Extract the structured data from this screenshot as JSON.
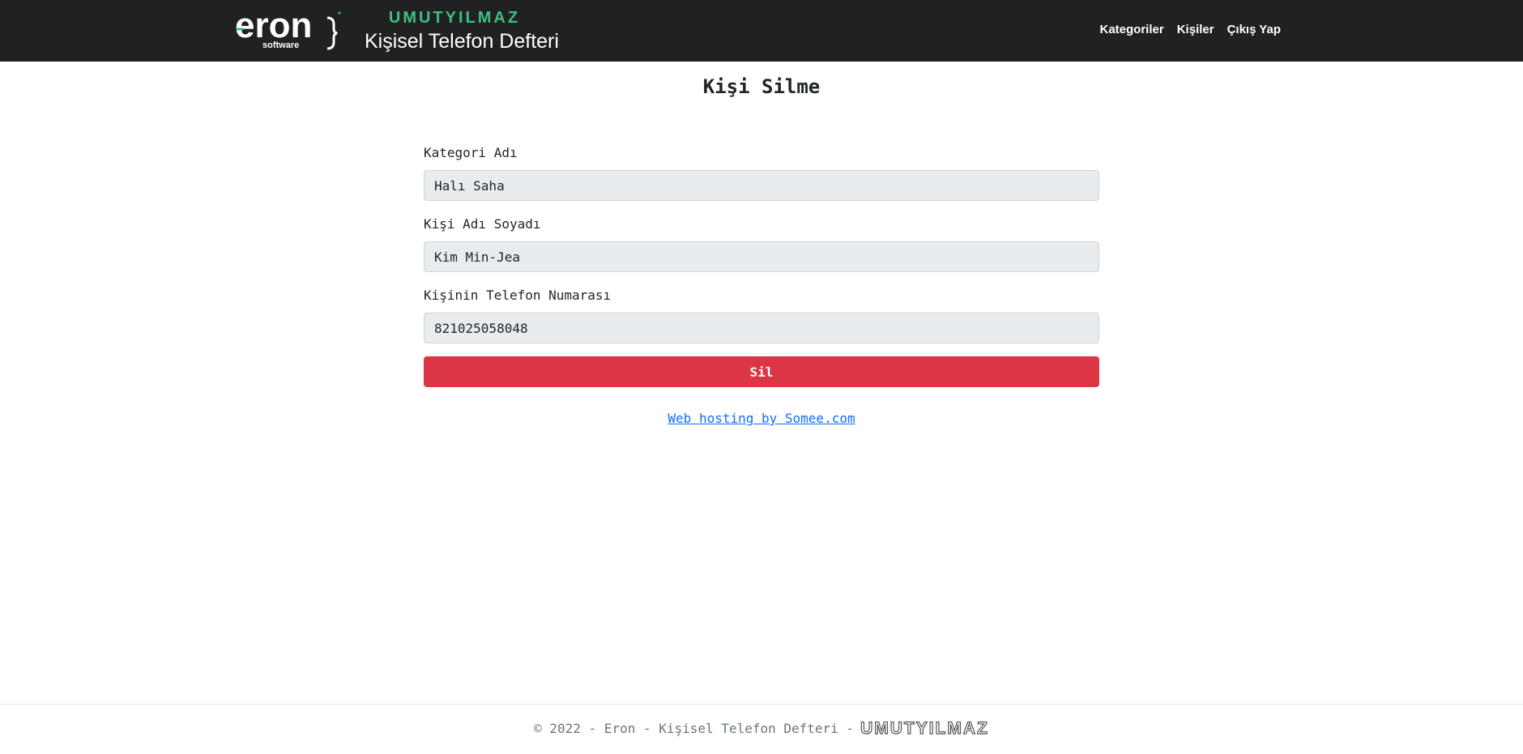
{
  "header": {
    "logo_text": "eron",
    "logo_subtext": "software",
    "brand_name": "UMUTYILMAZ",
    "brand_subtitle": "Kişisel Telefon Defteri",
    "nav": [
      {
        "label": "Kategoriler"
      },
      {
        "label": "Kişiler"
      },
      {
        "label": "Çıkış Yap"
      }
    ],
    "accent_color": "#3fbf82"
  },
  "main": {
    "title": "Kişi Silme",
    "fields": [
      {
        "label": "Kategori Adı",
        "value": "Halı Saha"
      },
      {
        "label": "Kişi Adı Soyadı",
        "value": "Kim Min-Jea"
      },
      {
        "label": "Kişinin Telefon Numarası",
        "value": "821025058048"
      }
    ],
    "submit_label": "Sil",
    "submit_color": "#dc3545"
  },
  "hosting": {
    "link_text": "Web hosting by Somee.com"
  },
  "footer": {
    "text": "© 2022 - Eron - Kişisel Telefon Defteri -",
    "brand": "UMUTYILMAZ"
  }
}
